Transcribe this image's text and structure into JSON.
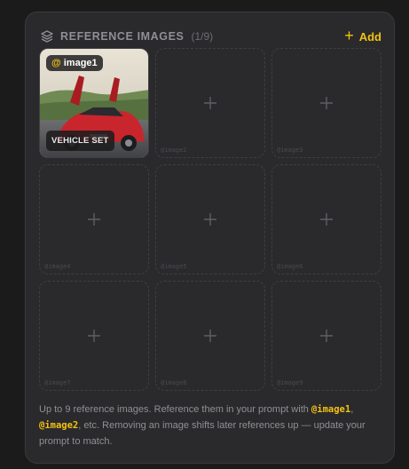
{
  "header": {
    "title": "REFERENCE IMAGES",
    "count": "(1/9)",
    "add_label": "Add",
    "icon": "layers-icon"
  },
  "slots": [
    {
      "ref": "@image1",
      "ref_at": "@",
      "ref_name": "image1",
      "caption": "VEHICLE SET",
      "filled": true
    },
    {
      "ref": "@image2",
      "filled": false
    },
    {
      "ref": "@image3",
      "filled": false
    },
    {
      "ref": "@image4",
      "filled": false
    },
    {
      "ref": "@image5",
      "filled": false
    },
    {
      "ref": "@image6",
      "filled": false
    },
    {
      "ref": "@image7",
      "filled": false
    },
    {
      "ref": "@image8",
      "filled": false
    },
    {
      "ref": "@image9",
      "filled": false
    }
  ],
  "help": {
    "part1": "Up to 9 reference images. Reference them in your prompt with ",
    "code1": "@image1",
    "sep": ", ",
    "code2": "@image2",
    "part2": ", etc. Removing an image shifts later references up — update your prompt to match."
  },
  "colors": {
    "accent": "#f3c114",
    "panel": "#2a2a2c",
    "background": "#1b1b1c"
  }
}
